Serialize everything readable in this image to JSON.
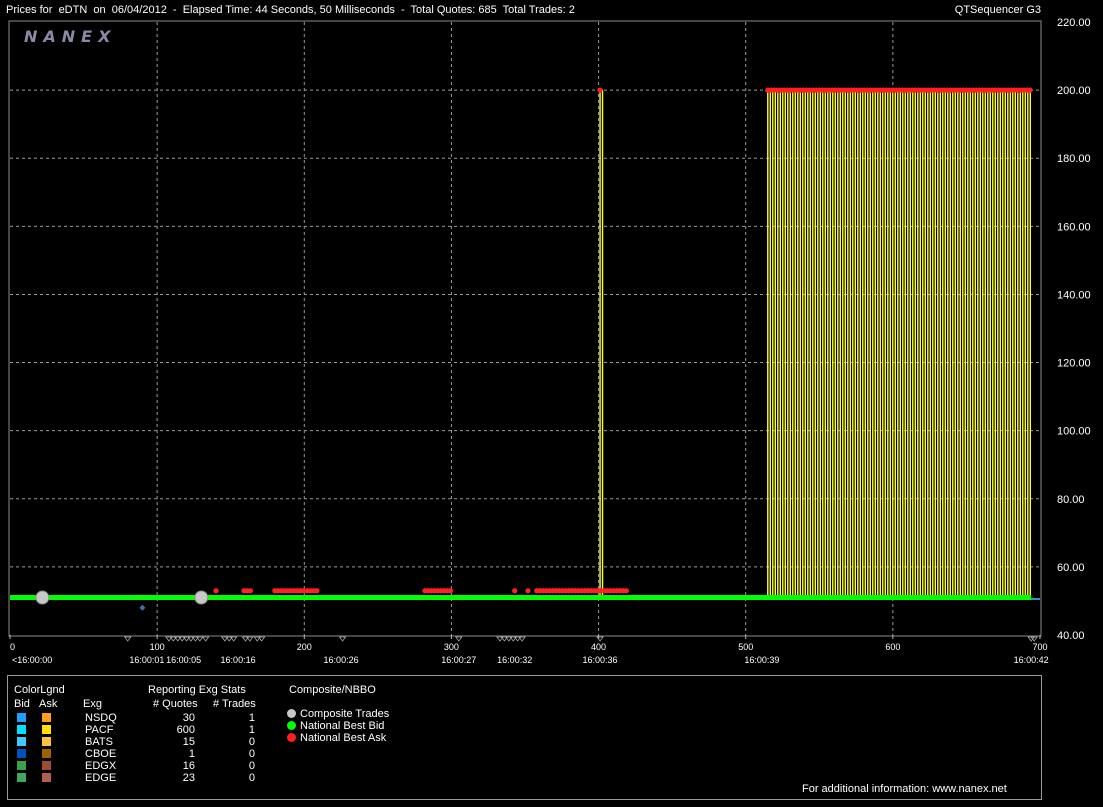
{
  "header": {
    "title": "Prices for  eDTN  on  06/04/2012  -  Elapsed Time: 44 Seconds, 50 Milliseconds  -  Total Quotes: 685  Total Trades: 2",
    "app_name": "QTSequencer G3",
    "logo_text": "NANEX"
  },
  "chart_data": {
    "type": "line",
    "ylim": [
      40,
      220
    ],
    "xlim": [
      0,
      700
    ],
    "y_ticks": [
      "220.00",
      "200.00",
      "180.00",
      "160.00",
      "140.00",
      "120.00",
      "100.00",
      "80.00",
      "60.00",
      "40.00"
    ],
    "y_tick_values": [
      220,
      200,
      180,
      160,
      140,
      120,
      100,
      80,
      60,
      40
    ],
    "x_ticks": [
      {
        "value": 0,
        "label": "0"
      },
      {
        "value": 100,
        "label": "100"
      },
      {
        "value": 200,
        "label": "200"
      },
      {
        "value": 300,
        "label": "300"
      },
      {
        "value": 400,
        "label": "400"
      },
      {
        "value": 500,
        "label": "500"
      },
      {
        "value": 600,
        "label": "600"
      },
      {
        "value": 700,
        "label": "700"
      }
    ],
    "time_labels": [
      {
        "value": 0,
        "label": "<16:00:00"
      },
      {
        "value": 93,
        "label": "16:00:01"
      },
      {
        "value": 118,
        "label": "16:00:05"
      },
      {
        "value": 155,
        "label": "16:00:16"
      },
      {
        "value": 225,
        "label": "16:00:26"
      },
      {
        "value": 305,
        "label": "16:00:27"
      },
      {
        "value": 343,
        "label": "16:00:32"
      },
      {
        "value": 401,
        "label": "16:00:36"
      },
      {
        "value": 511,
        "label": "16:00:39"
      },
      {
        "value": 694,
        "label": "16:00:42"
      }
    ],
    "series": [
      {
        "name": "National Best Bid",
        "color": "#00ff00",
        "y": 51
      },
      {
        "name": "National Best Ask",
        "color": "#ff2020",
        "segments": [
          {
            "x_start": 140,
            "x_end": 142,
            "y": 53
          },
          {
            "x_start": 159,
            "x_end": 164,
            "y": 53
          },
          {
            "x_start": 180,
            "x_end": 200,
            "y": 53
          },
          {
            "x_start": 202,
            "x_end": 210,
            "y": 53
          },
          {
            "x_start": 282,
            "x_end": 300,
            "y": 53
          },
          {
            "x_start": 343,
            "x_end": 343,
            "y": 53
          },
          {
            "x_start": 352,
            "x_end": 352,
            "y": 53
          },
          {
            "x_start": 358,
            "x_end": 420,
            "y": 53
          },
          {
            "x_start": 401,
            "x_end": 403,
            "y": 200
          },
          {
            "x_start": 515,
            "x_end": 694,
            "y": 200
          }
        ]
      },
      {
        "name": "Composite Trades",
        "color": "#c8c8c8",
        "points": [
          {
            "x": 22,
            "y": 51
          },
          {
            "x": 130,
            "y": 51
          }
        ]
      }
    ],
    "spread_fill": [
      {
        "x_start": 401,
        "x_end": 403,
        "y_low": 51,
        "y_high": 200
      },
      {
        "x_start": 515,
        "x_end": 694,
        "y_low": 51,
        "y_high": 200
      }
    ],
    "spread_color": "#ffff40",
    "bid_line_color": "#40c0ff",
    "grid": true
  },
  "legend": {
    "color_legend_title": "ColorLgnd",
    "bid_col": "Bid",
    "ask_col": "Ask",
    "exg_col": "Exg",
    "stats_title": "Reporting Exg Stats",
    "quotes_col": "# Quotes",
    "trades_col": "# Trades",
    "nbbo_title": "Composite/NBBO",
    "exchanges": [
      {
        "name": "NSDQ",
        "quotes": "30",
        "trades": "1",
        "bid_color": "#1f9fff",
        "ask_color": "#ff9f1f"
      },
      {
        "name": "PACF",
        "quotes": "600",
        "trades": "1",
        "bid_color": "#00e0ff",
        "ask_color": "#ffe000"
      },
      {
        "name": "BATS",
        "quotes": "15",
        "trades": "0",
        "bid_color": "#40c8ff",
        "ask_color": "#ffc040"
      },
      {
        "name": "CBOE",
        "quotes": "1",
        "trades": "0",
        "bid_color": "#0050c0",
        "ask_color": "#a06000"
      },
      {
        "name": "EDGX",
        "quotes": "16",
        "trades": "0",
        "bid_color": "#3aa04a",
        "ask_color": "#a04a3a"
      },
      {
        "name": "EDGE",
        "quotes": "23",
        "trades": "0",
        "bid_color": "#40a860",
        "ask_color": "#b06050"
      }
    ],
    "nbbo_items": [
      {
        "label": "Composite Trades",
        "color": "#c8c8c8"
      },
      {
        "label": "National Best Bid",
        "color": "#00ff00"
      },
      {
        "label": "National Best Ask",
        "color": "#ff2020"
      }
    ],
    "footer": "For additional information: www.nanex.net"
  }
}
